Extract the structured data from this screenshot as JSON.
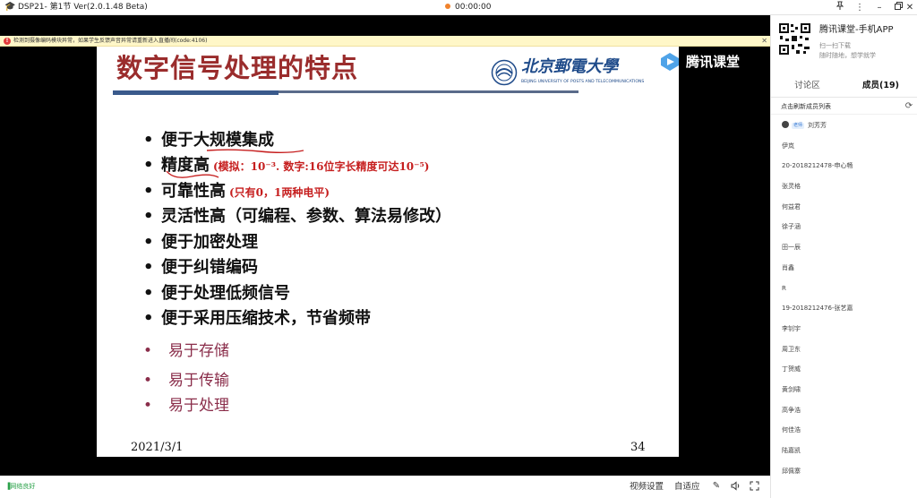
{
  "window": {
    "title": "DSP21- 第1节 Ver(2.0.1.48 Beta)",
    "timer": "00:00:00",
    "buttons": [
      "pin-icon",
      "more-icon",
      "minimize-icon",
      "restore-icon",
      "close-icon"
    ]
  },
  "warning": {
    "text": "检测到摄像编码模块异常，如果学生反馈声音异常请重新进入直播间(code:4106)"
  },
  "slide": {
    "title": "数字信号处理的特点",
    "university_cn": "北京郵電大學",
    "university_en": "BEIJING UNIVERSITY OF POSTS AND TELECOMMUNICATIONS",
    "bullets": [
      {
        "text": "便于大规模集成",
        "note": ""
      },
      {
        "text": "精度高",
        "note": "(模拟：10⁻³.  数字:16位字长精度可达10⁻⁵)"
      },
      {
        "text": "可靠性高",
        "note": "(只有0，1两种电平)"
      },
      {
        "text": "灵活性高（可编程、参数、算法易修改）",
        "note": ""
      },
      {
        "text": "便于加密处理",
        "note": ""
      },
      {
        "text": "便于纠错编码",
        "note": ""
      },
      {
        "text": "便于处理低频信号",
        "note": ""
      },
      {
        "text": "便于采用压缩技术，节省频带",
        "note": ""
      }
    ],
    "sub_bullets": [
      "易于存储",
      "易于传输",
      "易于处理"
    ],
    "date": "2021/3/1",
    "page_number": "34"
  },
  "watermark": {
    "text": "腾讯课堂"
  },
  "bottom_bar": {
    "network_status": "网络良好",
    "video_settings": "视频设置",
    "fit": "自适应"
  },
  "side_panel": {
    "app_name": "腾讯课堂-手机APP",
    "app_sub1": "扫一扫下载",
    "app_sub2": "随时随地，想学就学",
    "tabs": [
      {
        "label": "讨论区",
        "active": false
      },
      {
        "label": "成员(19)",
        "active": true
      }
    ],
    "list_header": "点击刷新成员列表",
    "teacher_badge": "老师",
    "members": [
      "刘芳芳",
      "伊岚",
      "20-2018212478-申心畅",
      "张灵格",
      "何益君",
      "徐子涵",
      "田一辰",
      "肖鑫",
      "R",
      "19-2018212476-张艺嘉",
      "李钊宇",
      "周卫东",
      "丁贺威",
      "黄剑啸",
      "高争浩",
      "何佳浩",
      "陆嘉凯",
      "邱佩寨"
    ]
  }
}
